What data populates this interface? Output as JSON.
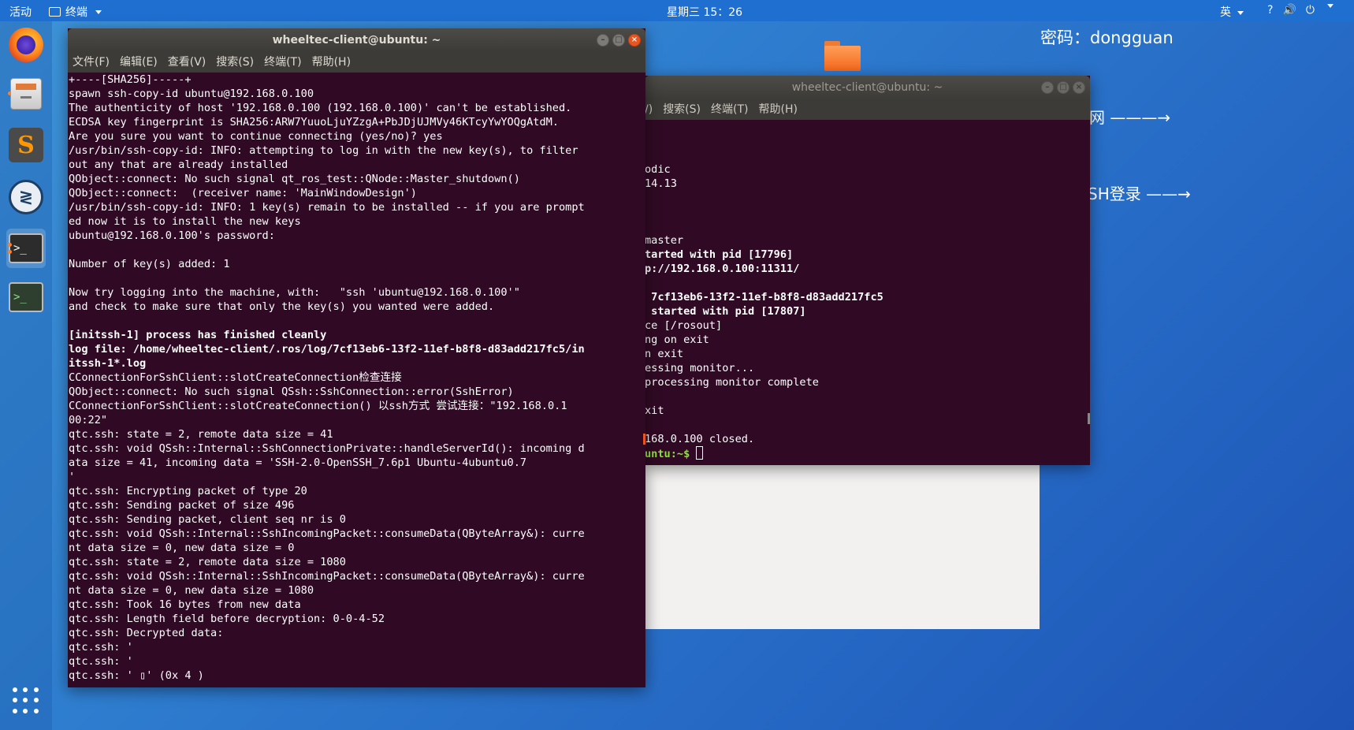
{
  "topbar": {
    "activities": "活动",
    "app_menu": "终端",
    "clock": "星期三 15：26",
    "ime": "英",
    "sys_icons": [
      "?",
      "🔊",
      "⏻"
    ]
  },
  "desktop": {
    "password": "密码：dongguan",
    "note_1": "网 ———→",
    "note_2": "SH登录 ——→"
  },
  "front_window": {
    "title": "wheeltec-client@ubuntu: ~",
    "menu": [
      "文件(F)",
      "编辑(E)",
      "查看(V)",
      "搜索(S)",
      "终端(T)",
      "帮助(H)"
    ],
    "lines": [
      "+----[SHA256]-----+",
      "spawn ssh-copy-id ubuntu@192.168.0.100",
      "The authenticity of host '192.168.0.100 (192.168.0.100)' can't be established.",
      "ECDSA key fingerprint is SHA256:ARW7YuuoLjuYZzgA+PbJDjUJMVy46KTcyYwYOQgAtdM.",
      "Are you sure you want to continue connecting (yes/no)? yes",
      "/usr/bin/ssh-copy-id: INFO: attempting to log in with the new key(s), to filter",
      "out any that are already installed",
      "QObject::connect: No such signal qt_ros_test::QNode::Master_shutdown()",
      "QObject::connect:  (receiver name: 'MainWindowDesign')",
      "/usr/bin/ssh-copy-id: INFO: 1 key(s) remain to be installed -- if you are prompt",
      "ed now it is to install the new keys",
      "ubuntu@192.168.0.100's password:",
      "",
      "Number of key(s) added: 1",
      "",
      "Now try logging into the machine, with:   \"ssh 'ubuntu@192.168.0.100'\"",
      "and check to make sure that only the key(s) you wanted were added.",
      "",
      "[initssh-1] process has finished cleanly",
      "log file: /home/wheeltec-client/.ros/log/7cf13eb6-13f2-11ef-b8f8-d83add217fc5/in",
      "itssh-1*.log",
      "CConnectionForSshClient::slotCreateConnection检查连接",
      "QObject::connect: No such signal QSsh::SshConnection::error(SshError)",
      "CConnectionForSshClient::slotCreateConnection() 以ssh方式 尝试连接：\"192.168.0.1",
      "00:22\"",
      "qtc.ssh: state = 2, remote data size = 41",
      "qtc.ssh: void QSsh::Internal::SshConnectionPrivate::handleServerId(): incoming d",
      "ata size = 41, incoming data = 'SSH-2.0-OpenSSH_7.6p1 Ubuntu-4ubuntu0.7",
      "'",
      "qtc.ssh: Encrypting packet of type 20",
      "qtc.ssh: Sending packet of size 496",
      "qtc.ssh: Sending packet, client seq nr is 0",
      "qtc.ssh: void QSsh::Internal::SshIncomingPacket::consumeData(QByteArray&): curre",
      "nt data size = 0, new data size = 0",
      "qtc.ssh: state = 2, remote data size = 1080",
      "qtc.ssh: void QSsh::Internal::SshIncomingPacket::consumeData(QByteArray&): curre",
      "nt data size = 0, new data size = 1080",
      "qtc.ssh: Took 16 bytes from new data",
      "qtc.ssh: Length field before decryption: 0-0-4-52",
      "qtc.ssh: Decrypted data:",
      "qtc.ssh: '",
      "qtc.ssh: '",
      "qtc.ssh: ' ▯' (0x 4 )"
    ],
    "bold_lines": [
      18,
      19,
      20
    ]
  },
  "back_window": {
    "title": "wheeltec-client@ubuntu: ~",
    "menu": [
      "/)",
      "搜索(S)",
      "终端(T)",
      "帮助(H)"
    ],
    "lines": [
      "",
      "",
      "",
      "odic",
      "14.13",
      "",
      "",
      "",
      "master",
      "tarted with pid [17796]",
      "p://192.168.0.100:11311/",
      "",
      " 7cf13eb6-13f2-11ef-b8f8-d83add217fc5",
      " started with pid [17807]",
      "ce [/rosout]",
      "ng on exit",
      "n exit",
      "essing monitor...",
      "processing monitor complete",
      "",
      "xit",
      "",
      "168.0.100 closed."
    ],
    "bold_lines": [
      9,
      10,
      12,
      13
    ],
    "prompt": "untu:~$ "
  }
}
